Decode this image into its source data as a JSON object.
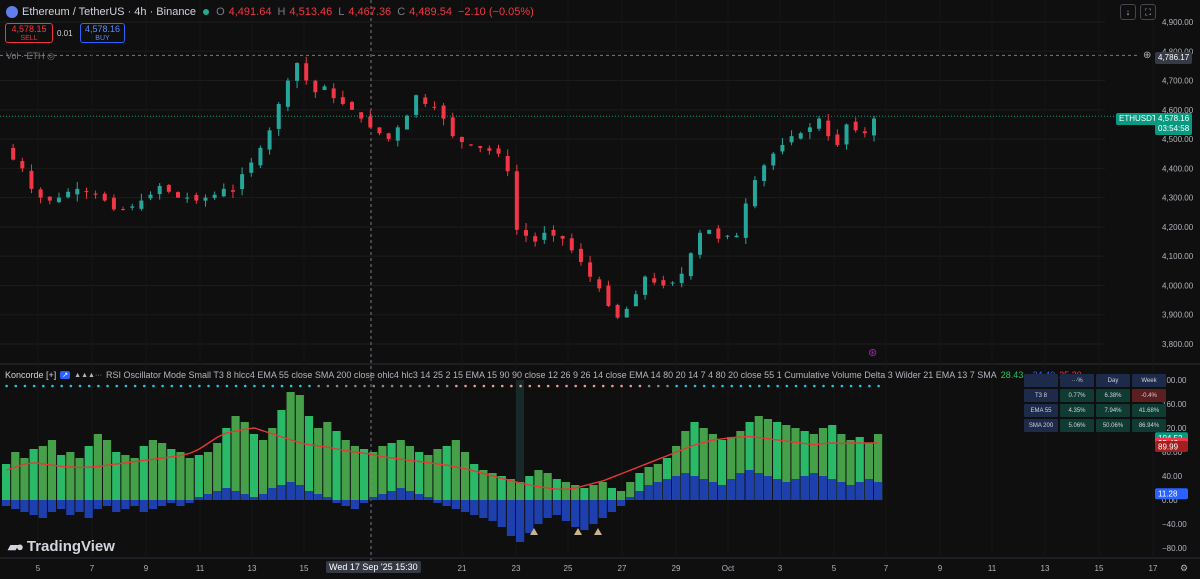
{
  "header": {
    "symbol": "Ethereum / TetherUS · 4h · Binance",
    "o_label": "O",
    "o": "4,491.64",
    "h_label": "H",
    "h": "4,513.46",
    "l_label": "L",
    "l": "4,467.36",
    "c_label": "C",
    "c": "4,489.54",
    "change": "−2.10 (−0.05%)",
    "sell_price": "4,578.15",
    "sell_label": "SELL",
    "spread": "0.01",
    "buy_price": "4,578.16",
    "buy_label": "BUY",
    "vol_label": "Vol · ETH"
  },
  "price_axis": {
    "ticks": [
      4900,
      4800,
      4700,
      4600,
      4500,
      4400,
      4300,
      4200,
      4100,
      4000,
      3900,
      3800
    ],
    "crosshair_label": "4,786.17",
    "last_symbol": "ETHUSDT",
    "last_price": "4,578.16",
    "countdown": "03:54:58",
    "last_price_value": 4578.16,
    "crosshair_value": 4786.17
  },
  "indicator": {
    "name": "Koncorde [+]",
    "params": "RSI Oscillator Mode Small T3 8 hlcc4 EMA 55 close SMA 200 close ohlc4 hlc3 14 25 2 15 EMA 15 90 90 close 12 26 9 26 14 close EMA 14 80 20 14 7 4 80 20 close 55 1 Cumulative Volume Delta 3 Wilder 21 EMA 13 7 SMA",
    "v1": "28.43",
    "v2": "−24.40",
    "v3": "25.20",
    "axis_ticks": [
      "200.00",
      "160.00",
      "120.00",
      "80.00",
      "40.00",
      "0.00",
      "−40.00",
      "−80.00"
    ],
    "axis_values": [
      200,
      160,
      120,
      80,
      40,
      0,
      -40,
      -80
    ],
    "badges": [
      {
        "text": "104.52",
        "value": 104.52,
        "color": "#089981"
      },
      {
        "text": "95.43",
        "value": 95.43,
        "color": "#f23645"
      },
      {
        "text": "89.99",
        "value": 89.99,
        "color": "#a11f1f"
      },
      {
        "text": "11.28",
        "value": 11.28,
        "color": "#2962ff"
      }
    ],
    "table": {
      "header": [
        "···%",
        "Day",
        "Week"
      ],
      "rows": [
        {
          "name": "T3 8",
          "v": [
            "0.77%",
            "6.38%",
            "-0.4%"
          ]
        },
        {
          "name": "EMA 55",
          "v": [
            "4.35%",
            "7.94%",
            "41.68%"
          ]
        },
        {
          "name": "SMA 200",
          "v": [
            "5.06%",
            "50.06%",
            "86.94%"
          ]
        }
      ]
    }
  },
  "time_axis": {
    "labels": [
      {
        "t": "5",
        "x": 38
      },
      {
        "t": "7",
        "x": 92
      },
      {
        "t": "9",
        "x": 146
      },
      {
        "t": "11",
        "x": 200
      },
      {
        "t": "13",
        "x": 252
      },
      {
        "t": "15",
        "x": 304
      },
      {
        "t": "21",
        "x": 462
      },
      {
        "t": "23",
        "x": 516
      },
      {
        "t": "25",
        "x": 568
      },
      {
        "t": "27",
        "x": 622
      },
      {
        "t": "29",
        "x": 676
      },
      {
        "t": "Oct",
        "x": 728
      },
      {
        "t": "3",
        "x": 780
      },
      {
        "t": "5",
        "x": 834
      },
      {
        "t": "7",
        "x": 886
      },
      {
        "t": "9",
        "x": 940
      },
      {
        "t": "11",
        "x": 992
      },
      {
        "t": "13",
        "x": 1045
      },
      {
        "t": "15",
        "x": 1099
      },
      {
        "t": "17",
        "x": 1153
      }
    ],
    "crosshair_date": "Wed 17 Sep '25   15:30"
  },
  "brand": {
    "name": "TradingView"
  },
  "colors": {
    "up": "#089981",
    "down": "#f23645",
    "up_bright": "#26a69a",
    "bg": "#0f0f0f"
  },
  "chart_data": {
    "type": "candlestick",
    "title": "Ethereum / TetherUS · 4h · Binance",
    "ylim": [
      3750,
      4950
    ],
    "close_path": [
      4470,
      4430,
      4400,
      4330,
      4300,
      4290,
      4300,
      4320,
      4330,
      4320,
      4310,
      4290,
      4260,
      4260,
      4270,
      4290,
      4310,
      4340,
      4320,
      4300,
      4300,
      4290,
      4300,
      4310,
      4330,
      4320,
      4380,
      4420,
      4470,
      4530,
      4620,
      4700,
      4760,
      4700,
      4660,
      4680,
      4640,
      4620,
      4600,
      4570,
      4540,
      4520,
      4500,
      4540,
      4580,
      4650,
      4620,
      4610,
      4570,
      4510,
      4490,
      4480,
      4470,
      4460,
      4450,
      4390,
      4190,
      4170,
      4150,
      4180,
      4170,
      4160,
      4120,
      4080,
      4030,
      3990,
      3930,
      3890,
      3920,
      3970,
      4030,
      4010,
      4000,
      4010,
      4040,
      4110,
      4180,
      4190,
      4160,
      4170,
      4170,
      4280,
      4360,
      4410,
      4450,
      4480,
      4510,
      4520,
      4540,
      4570,
      4510,
      4480,
      4550,
      4530,
      4520,
      4570
    ],
    "koncorde_green": [
      60,
      80,
      70,
      85,
      90,
      100,
      75,
      80,
      70,
      90,
      110,
      100,
      80,
      75,
      70,
      90,
      100,
      95,
      85,
      80,
      70,
      75,
      80,
      95,
      120,
      140,
      130,
      110,
      100,
      120,
      150,
      180,
      175,
      140,
      120,
      130,
      115,
      100,
      90,
      85,
      80,
      90,
      95,
      100,
      90,
      80,
      75,
      85,
      90,
      100,
      80,
      60,
      50,
      45,
      40,
      35,
      30,
      40,
      50,
      45,
      35,
      30,
      25,
      20,
      25,
      30,
      20,
      15,
      30,
      45,
      55,
      60,
      70,
      90,
      115,
      130,
      120,
      110,
      100,
      105,
      115,
      130,
      140,
      135,
      130,
      125,
      120,
      115,
      110,
      120,
      125,
      110,
      100,
      105,
      95,
      110
    ],
    "koncorde_blue": [
      -10,
      -15,
      -20,
      -25,
      -30,
      -20,
      -15,
      -25,
      -20,
      -30,
      -15,
      -10,
      -20,
      -15,
      -10,
      -20,
      -15,
      -10,
      -5,
      -10,
      -5,
      5,
      10,
      15,
      20,
      15,
      10,
      5,
      10,
      20,
      25,
      30,
      25,
      15,
      10,
      5,
      -5,
      -10,
      -15,
      -5,
      5,
      10,
      15,
      20,
      15,
      10,
      5,
      -5,
      -10,
      -15,
      -20,
      -25,
      -30,
      -35,
      -45,
      -60,
      -70,
      -55,
      -40,
      -30,
      -25,
      -35,
      -45,
      -50,
      -40,
      -30,
      -20,
      -10,
      5,
      15,
      25,
      30,
      35,
      40,
      45,
      40,
      35,
      30,
      25,
      35,
      45,
      50,
      45,
      40,
      35,
      30,
      35,
      40,
      45,
      40,
      35,
      30,
      25,
      30,
      35,
      30
    ],
    "koncorde_avg": [
      50,
      55,
      60,
      62,
      60,
      58,
      56,
      55,
      54,
      55,
      56,
      58,
      60,
      62,
      64,
      66,
      68,
      70,
      72,
      74,
      78,
      85,
      95,
      105,
      112,
      115,
      118,
      120,
      115,
      110,
      105,
      100,
      95,
      92,
      90,
      88,
      85,
      82,
      80,
      78,
      75,
      72,
      70,
      68,
      66,
      64,
      62,
      60,
      58,
      55,
      52,
      48,
      44,
      40,
      36,
      32,
      28,
      25,
      22,
      20,
      18,
      18,
      20,
      24,
      28,
      32,
      38,
      44,
      50,
      56,
      62,
      68,
      74,
      80,
      86,
      92,
      96,
      100,
      102,
      104,
      105,
      106,
      104,
      102,
      100,
      98,
      96,
      94,
      92,
      94,
      95,
      94,
      95,
      95,
      95,
      95
    ]
  }
}
